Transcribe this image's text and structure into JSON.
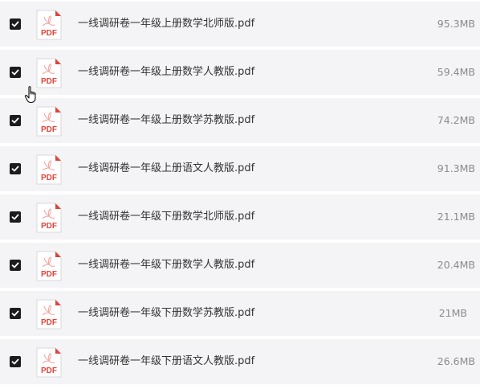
{
  "files": [
    {
      "name": "一线调研卷一年级上册数学北师版.pdf",
      "size": "95.3MB",
      "checked": true,
      "icon": "pdf-file-icon"
    },
    {
      "name": "一线调研卷一年级上册数学人教版.pdf",
      "size": "59.4MB",
      "checked": true,
      "icon": "pdf-file-icon"
    },
    {
      "name": "一线调研卷一年级上册数学苏教版.pdf",
      "size": "74.2MB",
      "checked": true,
      "icon": "pdf-file-icon"
    },
    {
      "name": "一线调研卷一年级上册语文人教版.pdf",
      "size": "91.3MB",
      "checked": true,
      "icon": "pdf-file-icon"
    },
    {
      "name": "一线调研卷一年级下册数学北师版.pdf",
      "size": "21.1MB",
      "checked": true,
      "icon": "pdf-file-icon"
    },
    {
      "name": "一线调研卷一年级下册数学人教版.pdf",
      "size": "20.4MB",
      "checked": true,
      "icon": "pdf-file-icon"
    },
    {
      "name": "一线调研卷一年级下册数学苏教版.pdf",
      "size": "21MB",
      "checked": true,
      "icon": "pdf-file-icon"
    },
    {
      "name": "一线调研卷一年级下册语文人教版.pdf",
      "size": "26.6MB",
      "checked": true,
      "icon": "pdf-file-icon"
    }
  ],
  "pdf_icon_label": "PDF",
  "colors": {
    "row_bg": "#f4f4f6",
    "checkbox": "#1c1c1f",
    "pdf_red": "#e0433a",
    "filename_text": "#333333",
    "size_text": "#8a8a8f"
  },
  "cursor": "hand-pointer-icon"
}
